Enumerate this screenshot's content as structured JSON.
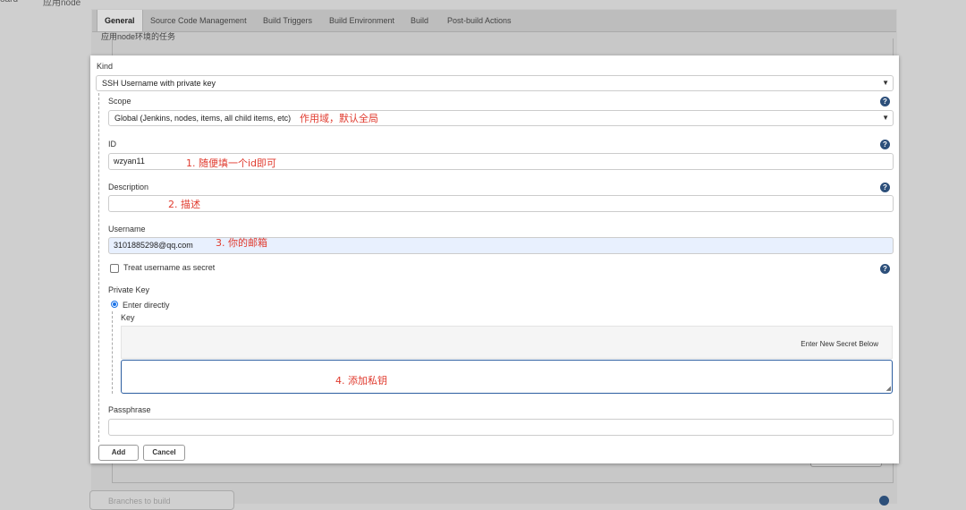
{
  "breadcrumb": {
    "item1": "oard",
    "item2": "应用node"
  },
  "tabs": [
    "General",
    "Source Code Management",
    "Build Triggers",
    "Build Environment",
    "Build",
    "Post-build Actions"
  ],
  "background": {
    "description": "应用node环境的任务",
    "branches_label": "Branches to build"
  },
  "dialog": {
    "kind_label": "Kind",
    "kind_value": "SSH Username with private key",
    "scope_label": "Scope",
    "scope_value": "Global (Jenkins, nodes, items, all child items, etc)",
    "scope_note": "作用域，默认全局",
    "id_label": "ID",
    "id_value": "wzyan11",
    "id_note": "1. 随便填一个id即可",
    "description_label": "Description",
    "description_value": "",
    "description_note": "2. 描述",
    "username_label": "Username",
    "username_value": "3101885298@qq.com",
    "username_note": "3. 你的邮箱",
    "treat_secret_label": "Treat username as secret",
    "treat_secret_checked": false,
    "private_key_label": "Private Key",
    "enter_directly_label": "Enter directly",
    "key_label": "Key",
    "enter_new_secret": "Enter New Secret Below",
    "key_note": "4. 添加私钥",
    "passphrase_label": "Passphrase",
    "passphrase_value": "",
    "add_button": "Add",
    "cancel_button": "Cancel"
  },
  "icons": {
    "help": "help-icon",
    "chevron": "chevron-down-icon",
    "resize": "resize-grip-icon"
  },
  "colors": {
    "annotation": "#e03a2e",
    "help_icon": "#2c4f7a",
    "focus_border": "#2c5ea0",
    "autofill_bg": "#e8f0fe"
  }
}
